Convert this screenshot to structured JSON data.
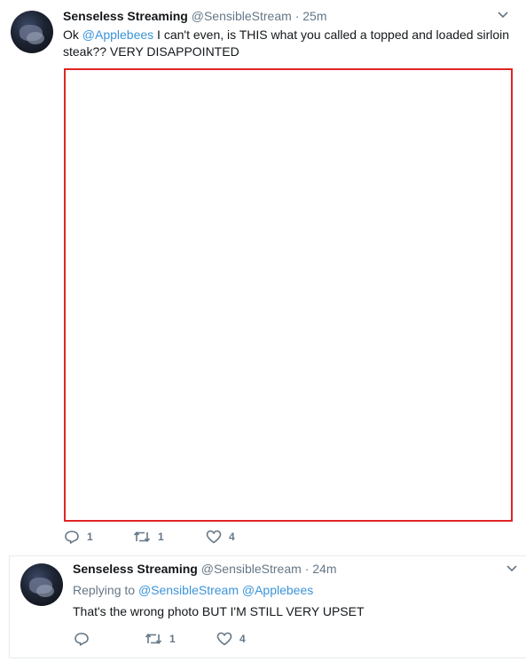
{
  "tweets": [
    {
      "author_name": "Senseless Streaming",
      "handle": "@SensibleStream",
      "separator": "·",
      "time": "25m",
      "text_before": "Ok ",
      "mention": "@Applebees",
      "text_after": " I can't even, is THIS what you called a topped and loaded sirloin steak?? VERY DISAPPOINTED",
      "reply_count": "1",
      "retweet_count": "1",
      "like_count": "4"
    },
    {
      "author_name": "Senseless Streaming",
      "handle": "@SensibleStream",
      "separator": "·",
      "time": "24m",
      "replying_label": "Replying to",
      "replying_to_1": "@SensibleStream",
      "replying_to_2": "@Applebees",
      "text": "That's the wrong photo BUT I'M STILL VERY UPSET",
      "reply_count": "",
      "retweet_count": "1",
      "like_count": "4"
    }
  ],
  "colors": {
    "link": "#3b94d9",
    "muted": "#657786",
    "media_border": "#e02424"
  },
  "icons": {
    "reply": "reply-icon",
    "retweet": "retweet-icon",
    "like": "heart-icon",
    "menu": "chevron-down-icon"
  }
}
